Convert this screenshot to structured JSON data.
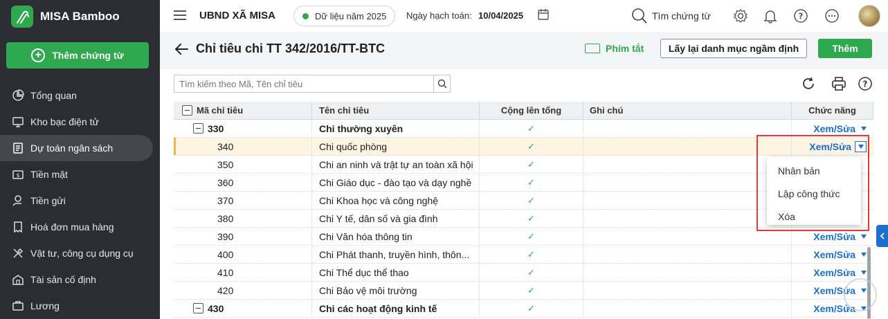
{
  "app": {
    "name": "MISA Bamboo"
  },
  "sidebar": {
    "add_button": "Thêm chứng từ",
    "items": [
      {
        "label": "Tổng quan",
        "icon": "pie-chart-icon"
      },
      {
        "label": "Kho bạc điện tử",
        "icon": "monitor-icon"
      },
      {
        "label": "Dự toán ngân sách",
        "icon": "budget-icon",
        "active": true
      },
      {
        "label": "Tiền mặt",
        "icon": "cash-icon"
      },
      {
        "label": "Tiền gửi",
        "icon": "deposit-icon"
      },
      {
        "label": "Hoá đơn mua hàng",
        "icon": "invoice-icon"
      },
      {
        "label": "Vật tư, công cụ dụng cụ",
        "icon": "tools-icon"
      },
      {
        "label": "Tài sản cố định",
        "icon": "asset-icon"
      },
      {
        "label": "Lương",
        "icon": "salary-icon"
      }
    ]
  },
  "topbar": {
    "org": "UBND XÃ MISA",
    "data_year": "Dữ liệu năm 2025",
    "accounting_date_label": "Ngày hạch toán:",
    "accounting_date": "10/04/2025",
    "search_label": "Tìm chứng từ"
  },
  "page": {
    "title": "Chỉ tiêu chi TT 342/2016/TT-BTC",
    "shortcut_label": "Phím tắt",
    "reset_button": "Lấy lại danh mục ngầm định",
    "add_button": "Thêm"
  },
  "search": {
    "placeholder": "Tìm kiếm theo Mã, Tên chỉ tiêu"
  },
  "table": {
    "headers": {
      "code": "Mã chỉ tiêu",
      "name": "Tên chỉ tiêu",
      "sum": "Cộng lên tổng",
      "note": "Ghi chú",
      "action": "Chức năng"
    },
    "action_label": "Xem/Sửa",
    "check_mark": "✓",
    "rows": [
      {
        "code": "330",
        "name": "Chi thường xuyên",
        "group": true
      },
      {
        "code": "340",
        "name": "Chi quốc phòng"
      },
      {
        "code": "350",
        "name": "Chi an ninh và trật tự an toàn xã hội"
      },
      {
        "code": "360",
        "name": "Chi Giáo dục - đào tạo và dạy nghề"
      },
      {
        "code": "370",
        "name": "Chi Khoa học và công nghệ"
      },
      {
        "code": "380",
        "name": "Chi Y tế, dân số và gia đình"
      },
      {
        "code": "390",
        "name": "Chi Văn hóa thông tin"
      },
      {
        "code": "400",
        "name": "Chi Phát thanh, truyền hình, thôn..."
      },
      {
        "code": "410",
        "name": "Chi Thể dục thể thao"
      },
      {
        "code": "420",
        "name": "Chi Bảo vệ môi trường"
      },
      {
        "code": "430",
        "name": "Chi các hoạt động kinh tế",
        "group": true
      }
    ]
  },
  "dropdown": {
    "items": [
      "Nhân bản",
      "Lập công thức",
      "Xóa"
    ]
  },
  "colors": {
    "primary_green": "#2fa84f",
    "link_blue": "#1a6fd1",
    "sidebar_bg": "#2b2d33",
    "highlight_red": "#e53935"
  }
}
